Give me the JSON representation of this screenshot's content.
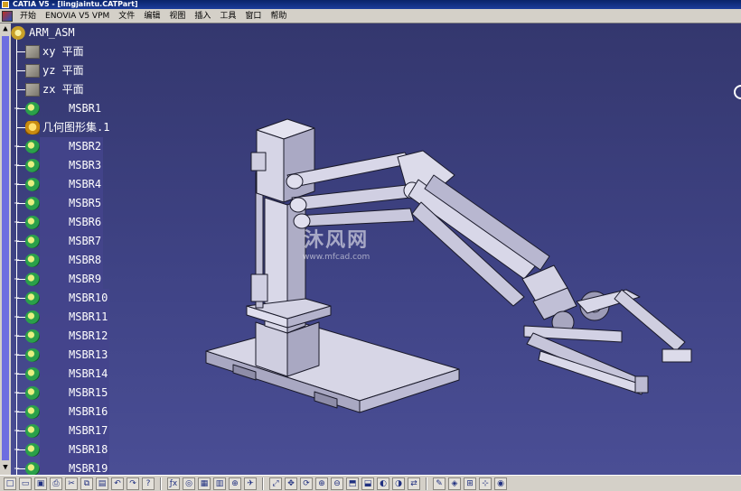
{
  "window": {
    "title": "CATIA V5 - [lingjaintu.CATPart]"
  },
  "menu": [
    {
      "label": "开始"
    },
    {
      "label": "ENOVIA V5 VPM"
    },
    {
      "label": "文件"
    },
    {
      "label": "编辑"
    },
    {
      "label": "视图"
    },
    {
      "label": "插入"
    },
    {
      "label": "工具"
    },
    {
      "label": "窗口"
    },
    {
      "label": "帮助"
    }
  ],
  "tree": {
    "root": {
      "label": "ARM_ASM",
      "icon": "assembly-icon"
    },
    "planes": [
      {
        "label": "xy 平面",
        "icon": "plane-icon"
      },
      {
        "label": "yz 平面",
        "icon": "plane-icon"
      },
      {
        "label": "zx 平面",
        "icon": "plane-icon"
      }
    ],
    "first_part": {
      "label": "MSBR1",
      "icon": "part-icon"
    },
    "geometry_set": {
      "label": "几何图形集.1",
      "icon": "geometrical-set-icon"
    },
    "parts": [
      {
        "label": "MSBR2"
      },
      {
        "label": "MSBR3"
      },
      {
        "label": "MSBR4"
      },
      {
        "label": "MSBR5"
      },
      {
        "label": "MSBR6"
      },
      {
        "label": "MSBR7"
      },
      {
        "label": "MSBR8"
      },
      {
        "label": "MSBR9"
      },
      {
        "label": "MSBR10"
      },
      {
        "label": "MSBR11"
      },
      {
        "label": "MSBR12"
      },
      {
        "label": "MSBR13"
      },
      {
        "label": "MSBR14"
      },
      {
        "label": "MSBR15"
      },
      {
        "label": "MSBR16"
      },
      {
        "label": "MSBR17"
      },
      {
        "label": "MSBR18"
      },
      {
        "label": "MSBR19"
      }
    ]
  },
  "watermark": {
    "brand": "沐风网",
    "url": "www.mfcad.com"
  },
  "colors": {
    "background_top": "#34376e",
    "background_bottom": "#4a4e95",
    "model_face": "#dcdbe8",
    "model_edge": "#1a1a2a",
    "tree_text": "#ffffff",
    "selection": "#44448c"
  },
  "toolbar": [
    "new-icon",
    "open-icon",
    "save-icon",
    "print-icon",
    "cut-icon",
    "copy-icon",
    "paste-icon",
    "undo-icon",
    "redo-icon",
    "whats-this-icon",
    "formula-icon",
    "knowledge-icon",
    "table-icon",
    "catalog-icon",
    "measure-icon",
    "fly-icon",
    "fit-all-icon",
    "pan-icon",
    "rotate-icon",
    "zoom-in-icon",
    "zoom-out-icon",
    "normal-view-icon",
    "iso-view-icon",
    "shading-icon",
    "hide-show-icon",
    "swap-icon",
    "sketch-icon",
    "analysis-icon",
    "snap-icon",
    "manipulate-icon",
    "capture-icon"
  ]
}
